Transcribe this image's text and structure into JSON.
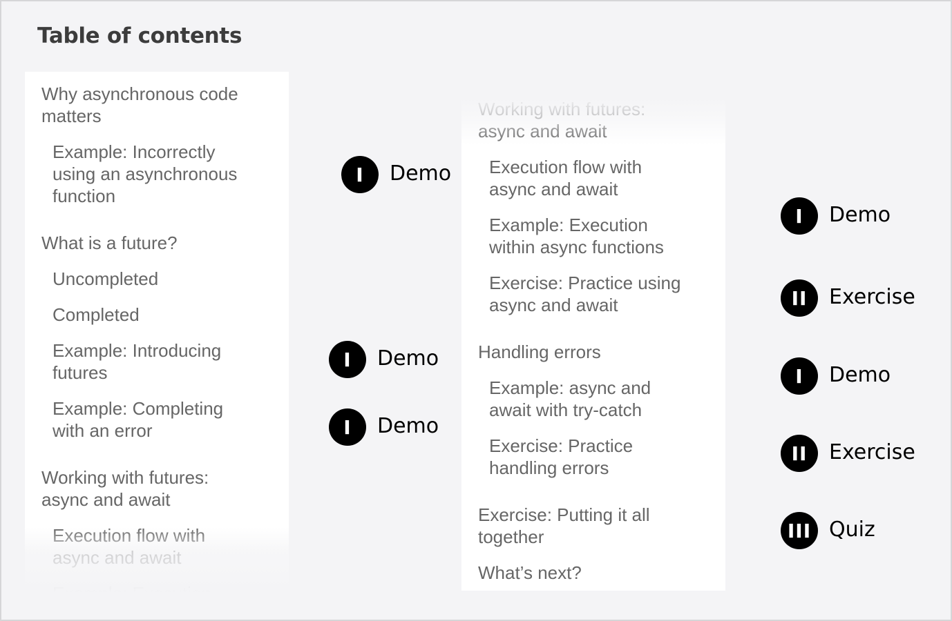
{
  "title": "Table of contents",
  "colors": {
    "bracket": "#d0176c",
    "badge_bg": "#000000",
    "badge_text": "#ffffff",
    "item_text": "#666666",
    "title_text": "#3c3c3c",
    "page_bg": "#f4f4f6",
    "panel_bg": "#ffffff"
  },
  "left_panel": {
    "items": [
      {
        "level": "section",
        "text": "Why asynchronous code\nmatters"
      },
      {
        "level": "sub",
        "text": "Example: Incorrectly\nusing an asynchronous\nfunction"
      },
      {
        "level": "section",
        "text": "What is a future?"
      },
      {
        "level": "sub",
        "text": "Uncompleted"
      },
      {
        "level": "sub",
        "text": "Completed"
      },
      {
        "level": "sub",
        "text": "Example: Introducing\nfutures"
      },
      {
        "level": "sub",
        "text": "Example: Completing\nwith an error"
      },
      {
        "level": "section",
        "text": "Working with futures:\nasync and await"
      },
      {
        "level": "sub",
        "text": "Execution flow with\nasync and await"
      },
      {
        "level": "sub",
        "text": "Example: Execution"
      }
    ]
  },
  "right_panel": {
    "items": [
      {
        "level": "section",
        "text": "Working with futures:\nasync and await"
      },
      {
        "level": "sub",
        "text": "Execution flow with\nasync and await"
      },
      {
        "level": "sub",
        "text": "Example: Execution\nwithin async functions"
      },
      {
        "level": "sub",
        "text": "Exercise: Practice using\nasync and await"
      },
      {
        "level": "section",
        "text": "Handling errors"
      },
      {
        "level": "sub",
        "text": "Example: async and\nawait with try-catch"
      },
      {
        "level": "sub",
        "text": "Exercise: Practice\nhandling errors"
      },
      {
        "level": "section",
        "text": "Exercise: Putting it all\ntogether"
      },
      {
        "level": "section",
        "text": "What’s next?"
      }
    ]
  },
  "annotations": [
    {
      "numeral": "I",
      "label": "Demo",
      "target": "Example: Incorrectly using an asynchronous function"
    },
    {
      "numeral": "I",
      "label": "Demo",
      "target": "Example: Introducing futures"
    },
    {
      "numeral": "I",
      "label": "Demo",
      "target": "Example: Completing with an error"
    },
    {
      "numeral": "I",
      "label": "Demo",
      "target": "Example: Execution within async functions"
    },
    {
      "numeral": "II",
      "label": "Exercise",
      "target": "Exercise: Practice using async and await"
    },
    {
      "numeral": "I",
      "label": "Demo",
      "target": "Example: async and await with try-catch"
    },
    {
      "numeral": "II",
      "label": "Exercise",
      "target": "Exercise: Practice handling errors"
    },
    {
      "numeral": "III",
      "label": "Quiz",
      "target": "Exercise: Putting it all together"
    }
  ]
}
